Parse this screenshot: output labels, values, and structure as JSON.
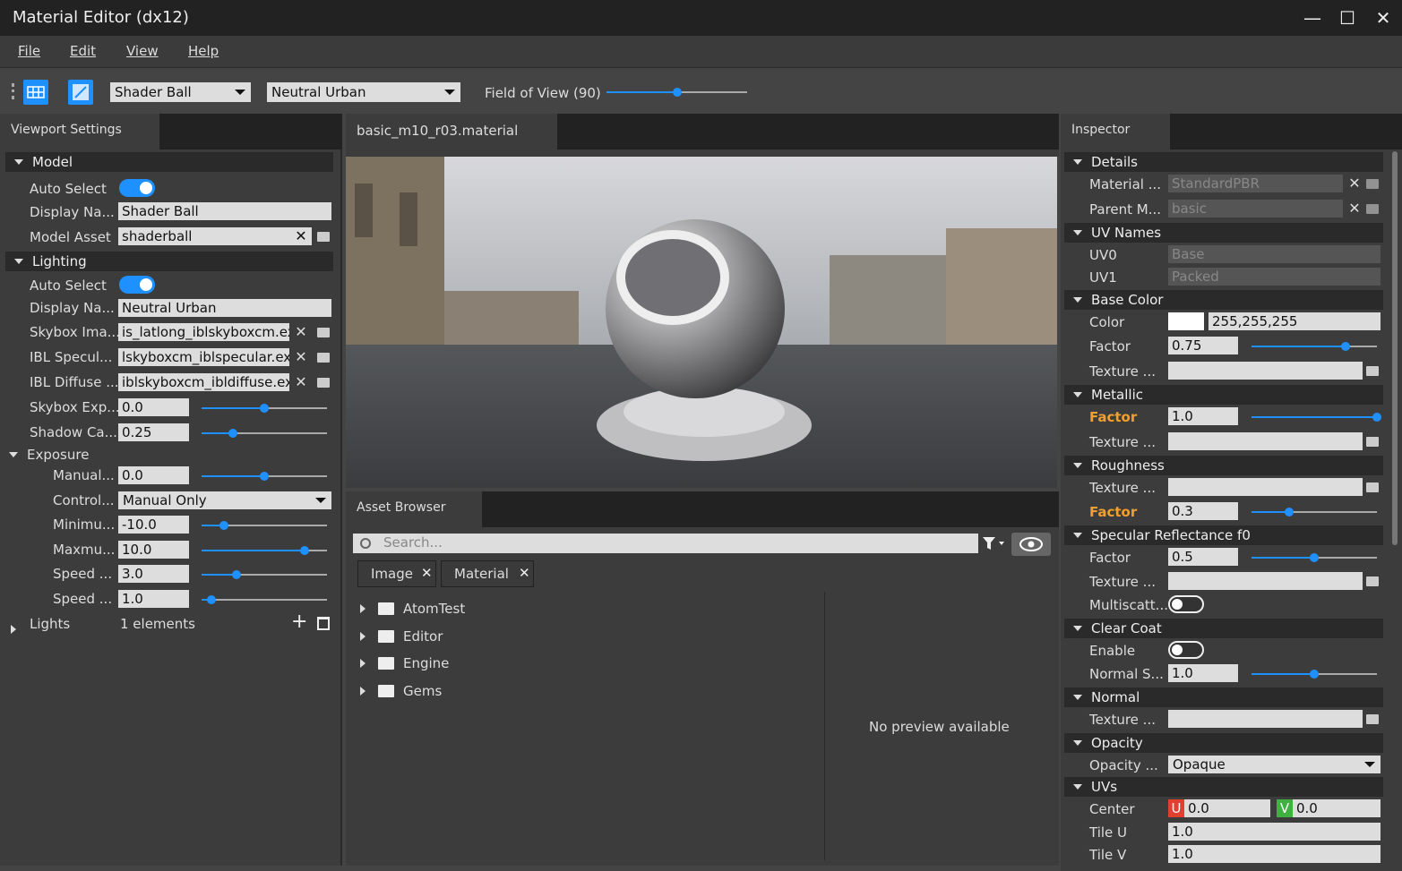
{
  "window": {
    "title": "Material Editor (dx12)",
    "minimize": "—",
    "maximize": "☐",
    "close": "✕"
  },
  "menu": [
    "File",
    "Edit",
    "View",
    "Help"
  ],
  "toolbar": {
    "model_combo": "Shader Ball",
    "lighting_combo": "Neutral Urban",
    "fov_label": "Field of View (90)",
    "fov_value": 0.5
  },
  "viewport_settings": {
    "tab": "Viewport Settings",
    "model_section": "Model",
    "model_rows": {
      "auto_select": "Auto Select",
      "display_name_label": "Display Na...",
      "display_name": "Shader Ball",
      "model_asset_label": "Model Asset",
      "model_asset": "shaderball"
    },
    "lighting_section": "Lighting",
    "lighting_rows": {
      "auto_select": "Auto Select",
      "display_name_label": "Display Na...",
      "display_name": "Neutral Urban",
      "skybox_image_label": "Skybox Ima...",
      "skybox_image": "is_latlong_iblskyboxcm.exr",
      "ibl_specular_label": "IBL Specul...",
      "ibl_specular": "lskyboxcm_iblspecular.exr",
      "ibl_diffuse_label": "IBL Diffuse ...",
      "ibl_diffuse": "iblskyboxcm_ibldiffuse.exr",
      "skybox_exposure_label": "Skybox Exp...",
      "skybox_exposure": "0.0",
      "skybox_exposure_pos": 0.5,
      "shadow_catcher_label": "Shadow Ca...",
      "shadow_catcher": "0.25",
      "shadow_catcher_pos": 0.25
    },
    "exposure_section": "Exposure",
    "exposure_rows": [
      {
        "label": "Manual...",
        "value": "0.0",
        "pos": 0.5,
        "type": "slider"
      },
      {
        "label": "Control...",
        "value": "Manual Only",
        "type": "combo"
      },
      {
        "label": "Minimu...",
        "value": "-10.0",
        "pos": 0.18,
        "type": "slider"
      },
      {
        "label": "Maxmu...",
        "value": "10.0",
        "pos": 0.82,
        "type": "slider"
      },
      {
        "label": "Speed ...",
        "value": "3.0",
        "pos": 0.28,
        "type": "slider"
      },
      {
        "label": "Speed ...",
        "value": "1.0",
        "pos": 0.08,
        "type": "slider"
      }
    ],
    "lights_label": "Lights",
    "lights_count": "1 elements"
  },
  "document": {
    "tab": "basic_m10_r03.material"
  },
  "asset_browser": {
    "tab": "Asset Browser",
    "search_placeholder": "Search...",
    "filters": [
      "Image",
      "Material"
    ],
    "tree": [
      "AtomTest",
      "Editor",
      "Engine",
      "Gems"
    ],
    "preview_text": "No preview available"
  },
  "inspector": {
    "tab": "Inspector",
    "details": "Details",
    "material_type_label": "Material ...",
    "material_type": "StandardPBR",
    "parent_label": "Parent M...",
    "parent": "basic",
    "uv_names": "UV Names",
    "uv0_label": "UV0",
    "uv0": "Base",
    "uv1_label": "UV1",
    "uv1": "Packed",
    "base_color": "Base Color",
    "color_label": "Color",
    "color_value": "255,255,255",
    "bc_factor_label": "Factor",
    "bc_factor": "0.75",
    "bc_factor_pos": 0.75,
    "bc_texture_label": "Texture ...",
    "metallic": "Metallic",
    "met_factor_label": "Factor",
    "met_factor": "1.0",
    "met_factor_pos": 1.0,
    "met_texture_label": "Texture ...",
    "roughness": "Roughness",
    "rough_texture_label": "Texture ...",
    "rough_factor_label": "Factor",
    "rough_factor": "0.3",
    "rough_factor_pos": 0.3,
    "specular": "Specular Reflectance f0",
    "spec_factor_label": "Factor",
    "spec_factor": "0.5",
    "spec_factor_pos": 0.5,
    "spec_texture_label": "Texture ...",
    "multiscatter_label": "Multiscatt...",
    "clear_coat": "Clear Coat",
    "cc_enable_label": "Enable",
    "cc_normal_label": "Normal S...",
    "cc_normal": "1.0",
    "cc_normal_pos": 0.5,
    "normal": "Normal",
    "normal_texture_label": "Texture ...",
    "opacity": "Opacity",
    "opacity_mode_label": "Opacity ...",
    "opacity_mode": "Opaque",
    "uvs": "UVs",
    "center_label": "Center",
    "center_u_tag": "U",
    "center_u": "0.0",
    "center_v_tag": "V",
    "center_v": "0.0",
    "tile_u_label": "Tile U",
    "tile_u": "1.0",
    "tile_v_label": "Tile V",
    "tile_v": "1.0"
  },
  "colors": {
    "accent": "#1e90ff",
    "highlight": "#f0a030",
    "u_tag": "#e04030",
    "v_tag": "#40b040"
  }
}
